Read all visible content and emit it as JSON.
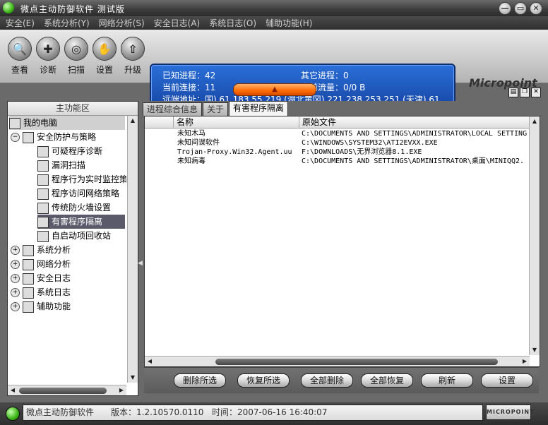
{
  "window": {
    "title": "微点主动防御软件  测试版",
    "btn_min": "—",
    "btn_restore": "▭",
    "btn_close": "✕"
  },
  "menu": [
    "安全(E)",
    "系统分析(Y)",
    "网络分析(S)",
    "安全日志(A)",
    "系统日志(O)",
    "辅助功能(H)"
  ],
  "toolbar": {
    "buttons": [
      {
        "label": "查看",
        "icon": "magnifier-icon",
        "glyph": "🔍"
      },
      {
        "label": "诊断",
        "icon": "stethoscope-icon",
        "glyph": "✚"
      },
      {
        "label": "扫描",
        "icon": "scan-icon",
        "glyph": "◎"
      },
      {
        "label": "设置",
        "icon": "hand-settings-icon",
        "glyph": "✋"
      },
      {
        "label": "升级",
        "icon": "upgrade-icon",
        "glyph": "⇧"
      }
    ]
  },
  "info": {
    "known_proc_label": "已知进程：42",
    "other_proc_label": "其它进程：0",
    "conn_label": "当前连接：11",
    "traffic_label": "当前流量：0/0 B",
    "remote_label": "远端地址：国)    61.183.55.219 (湖北黄冈)    221.238.253.251 (天津)    61"
  },
  "logo": "Micropoint",
  "sub_icons": [
    "▤",
    "❐",
    "✕"
  ],
  "left_panel": {
    "header": "主功能区",
    "tree": [
      {
        "label": "我的电脑",
        "level": 0,
        "icon": "computer-icon",
        "expander": ""
      },
      {
        "label": "安全防护与策略",
        "level": 1,
        "icon": "flag-icon",
        "expander": "−"
      },
      {
        "label": "可疑程序诊断",
        "level": 2,
        "icon": "diagnose-icon",
        "expander": ""
      },
      {
        "label": "漏洞扫描",
        "level": 2,
        "icon": "search-icon",
        "expander": ""
      },
      {
        "label": "程序行为实时监控策",
        "level": 2,
        "icon": "monitor-clock-icon",
        "expander": ""
      },
      {
        "label": "程序访问网络策略",
        "level": 2,
        "icon": "network-policy-icon",
        "expander": ""
      },
      {
        "label": "传统防火墙设置",
        "level": 2,
        "icon": "firewall-icon",
        "expander": ""
      },
      {
        "label": "有害程序隔离",
        "level": 2,
        "icon": "quarantine-icon",
        "expander": ""
      },
      {
        "label": "自启动项回收站",
        "level": 2,
        "icon": "recycle-icon",
        "expander": ""
      },
      {
        "label": "系统分析",
        "level": 1,
        "icon": "system-icon",
        "expander": "+"
      },
      {
        "label": "网络分析",
        "level": 1,
        "icon": "network-icon",
        "expander": "+"
      },
      {
        "label": "安全日志",
        "level": 1,
        "icon": "security-log-icon",
        "expander": "+"
      },
      {
        "label": "系统日志",
        "level": 1,
        "icon": "system-log-icon",
        "expander": "+"
      },
      {
        "label": "辅助功能",
        "level": 1,
        "icon": "tools-icon",
        "expander": "+"
      }
    ]
  },
  "tabs": [
    "进程综合信息",
    "关于",
    "有害程序隔离"
  ],
  "list": {
    "columns": [
      "名称",
      "原始文件"
    ],
    "rows": [
      {
        "name": "未知木马",
        "path": "C:\\DOCUMENTS AND SETTINGS\\ADMINISTRATOR\\LOCAL SETTING"
      },
      {
        "name": "未知间谍软件",
        "path": "C:\\WINDOWS\\SYSTEM32\\ATI2EVXX.EXE"
      },
      {
        "name": "Trojan-Proxy.Win32.Agent.uu",
        "path": "F:\\DOWNLOADS\\无界浏览器8.1.EXE"
      },
      {
        "name": "未知病毒",
        "path": "C:\\DOCUMENTS AND SETTINGS\\ADMINISTRATOR\\桌面\\MINIQQ2."
      }
    ]
  },
  "buttons": [
    "删除所选",
    "恢复所选",
    "全部删除",
    "全部恢复",
    "刷新",
    "设置"
  ],
  "status": {
    "app": "微点主动防御软件",
    "version": "版本：1.2.10570.0110",
    "time": "时间：2007-06-16 16:40:07",
    "logo": "MICROPOINT"
  }
}
